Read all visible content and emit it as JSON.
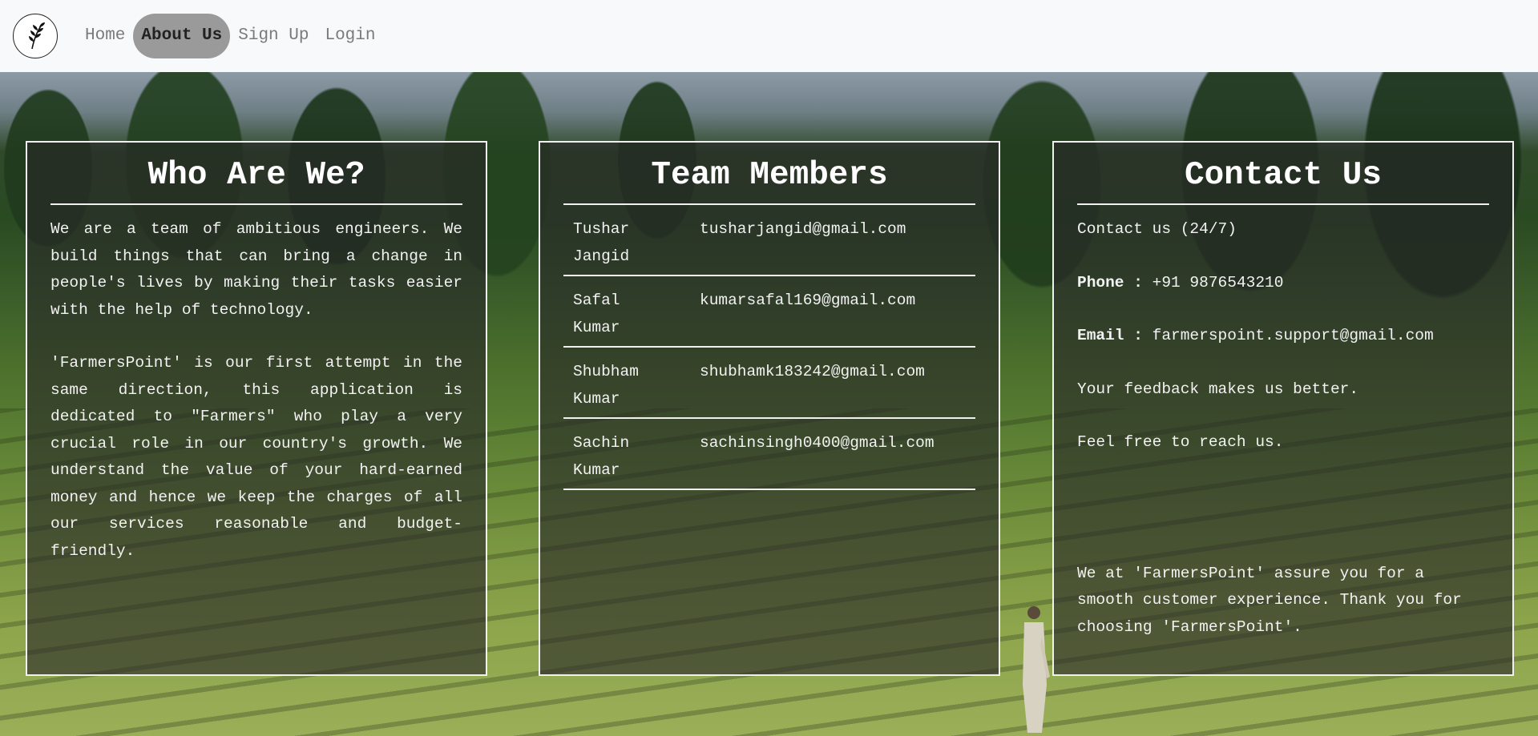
{
  "nav": {
    "items": [
      {
        "label": "Home"
      },
      {
        "label": "About Us"
      },
      {
        "label": "Sign Up"
      },
      {
        "label": "Login"
      }
    ],
    "active_index": 1
  },
  "who": {
    "title": "Who Are We?",
    "para1": "We are a team of ambitious engineers. We build things that can bring a change in people's lives by making their tasks easier with the help of technology.",
    "para2": "'FarmersPoint' is our first attempt in the same direction, this application is dedicated to \"Farmers\" who play a very crucial role in our country's growth. We understand the value of your hard-earned money and hence we keep the charges of all our services reasonable and budget-friendly."
  },
  "team": {
    "title": "Team Members",
    "members": [
      {
        "first": "Tushar",
        "last": "Jangid",
        "email": "tusharjangid@gmail.com"
      },
      {
        "first": "Safal",
        "last": "Kumar",
        "email": "kumarsafal169@gmail.com"
      },
      {
        "first": "Shubham",
        "last": "Kumar",
        "email": "shubhamk183242@gmail.com"
      },
      {
        "first": "Sachin",
        "last": "Kumar",
        "email": "sachinsingh0400@gmail.com"
      }
    ]
  },
  "contact": {
    "title": "Contact Us",
    "intro": "Contact us (24/7)",
    "phone_label": "Phone :",
    "phone": "+91 9876543210",
    "email_label": "Email :",
    "email": "farmerspoint.support@gmail.com",
    "feedback": "Your feedback makes us better.",
    "reach": "Feel free to reach us.",
    "closing": "We at 'FarmersPoint' assure you for a smooth customer experience. Thank you for choosing 'FarmersPoint'."
  }
}
